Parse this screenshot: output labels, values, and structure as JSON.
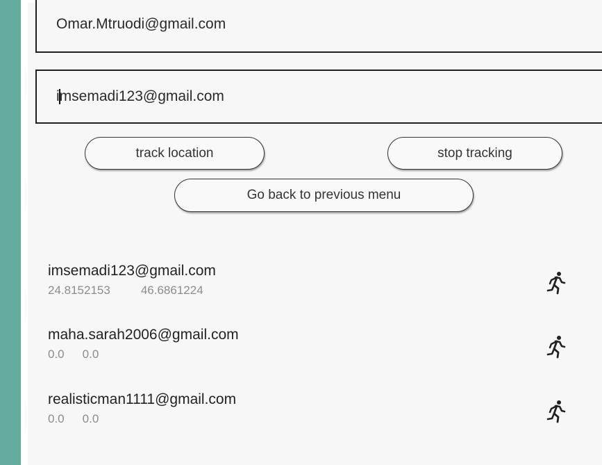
{
  "inputs": {
    "sender_email": {
      "value": "Omar.Mtruodi@gmail.com"
    },
    "target_email": {
      "value_before_cursor": "i",
      "value_after_cursor": "msemadi123@gmail.com"
    }
  },
  "buttons": {
    "track_location": "track location",
    "stop_tracking": "stop tracking",
    "go_back": "Go back to previous menu"
  },
  "tracked_users": [
    {
      "email": "imsemadi123@gmail.com",
      "lat": "24.8152153",
      "lng": "46.6861224",
      "icon": "running-person-icon"
    },
    {
      "email": "maha.sarah2006@gmail.com",
      "lat": "0.0",
      "lng": "0.0",
      "icon": "running-person-icon"
    },
    {
      "email": "realisticman1111@gmail.com",
      "lat": "0.0",
      "lng": "0.0",
      "icon": "running-person-icon"
    }
  ],
  "colors": {
    "side_background": "#63ac9e",
    "screen_background": "#f7f7f7",
    "coords_text": "#8c8c8c"
  }
}
